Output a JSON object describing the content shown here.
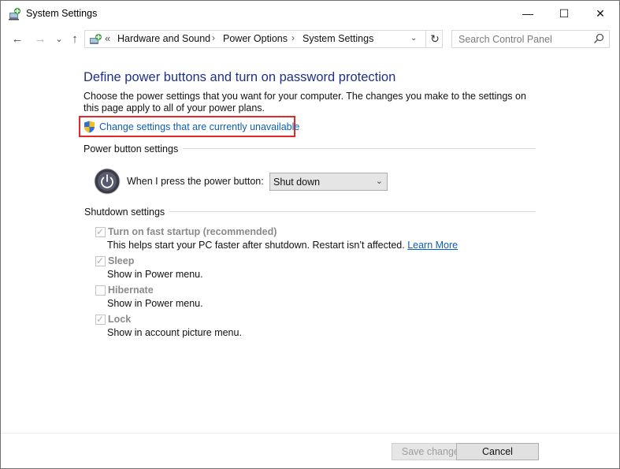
{
  "window": {
    "title": "System Settings",
    "controls": {
      "minimize": "—",
      "maximize": "☐",
      "close": "✕"
    }
  },
  "nav": {
    "back": "←",
    "forward": "→",
    "recent": "⌄",
    "up": "↑",
    "leading_chevron": "«",
    "breadcrumbs": [
      "Hardware and Sound",
      "Power Options",
      "System Settings"
    ],
    "separator": "›",
    "dropdown": "⌄",
    "refresh": "↻"
  },
  "search": {
    "placeholder": "Search Control Panel",
    "value": ""
  },
  "page": {
    "heading": "Define power buttons and turn on password protection",
    "description": "Choose the power settings that you want for your computer. The changes you make to the settings on this page apply to all of your power plans.",
    "change_link": "Change settings that are currently unavailable"
  },
  "power_button_settings": {
    "title": "Power button settings",
    "label": "When I press the power button:",
    "selected": "Shut down"
  },
  "shutdown_settings": {
    "title": "Shutdown settings",
    "options": [
      {
        "label": "Turn on fast startup (recommended)",
        "checked": true,
        "description": "This helps start your PC faster after shutdown. Restart isn’t affected.",
        "link": "Learn More"
      },
      {
        "label": "Sleep",
        "checked": true,
        "description": "Show in Power menu."
      },
      {
        "label": "Hibernate",
        "checked": false,
        "description": "Show in Power menu."
      },
      {
        "label": "Lock",
        "checked": true,
        "description": "Show in account picture menu."
      }
    ]
  },
  "footer": {
    "save": "Save changes",
    "cancel": "Cancel"
  },
  "colors": {
    "heading": "#1e3287",
    "link": "#0d5fb2",
    "highlight_box": "#e02a2a",
    "disabled_text": "#8a8a8a"
  }
}
